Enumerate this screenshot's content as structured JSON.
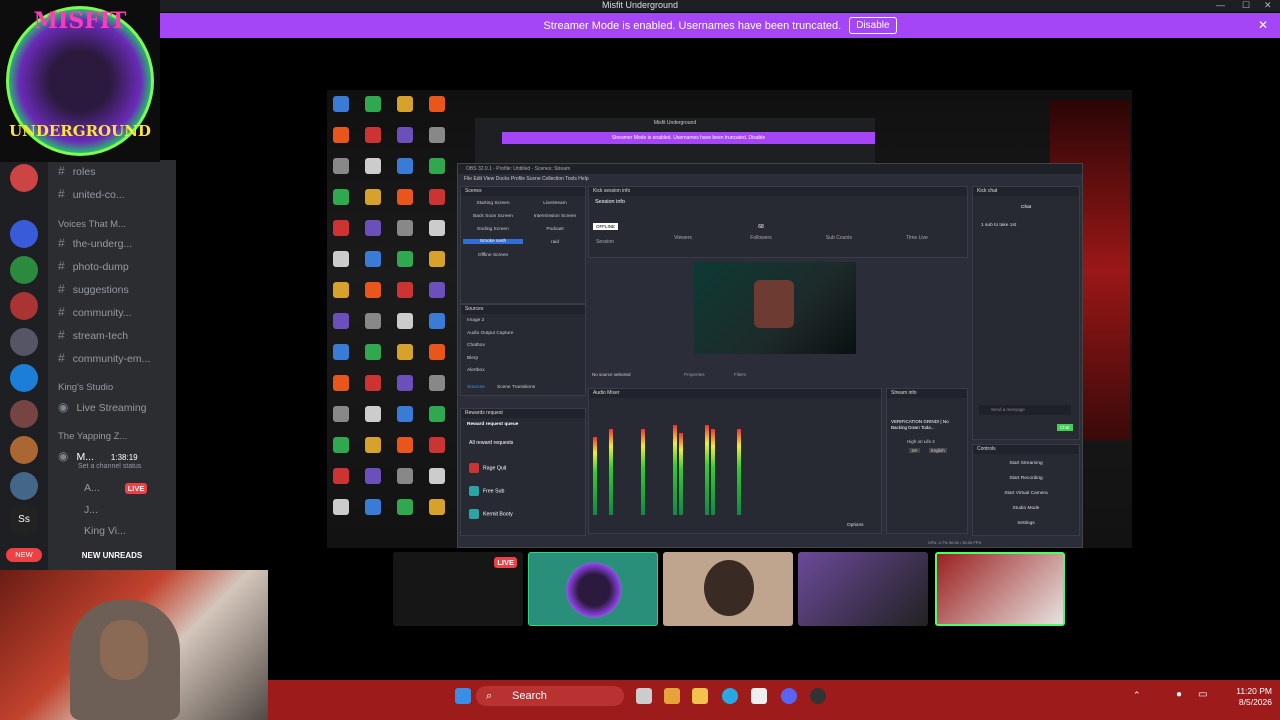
{
  "window": {
    "title": "Misfit Underground"
  },
  "banner": {
    "text": "Streamer Mode is enabled. Usernames have been truncated.",
    "button": "Disable"
  },
  "logo": {
    "line1": "MISFIT",
    "line2": "UNDERGROUND"
  },
  "channels": {
    "items": [
      {
        "label": "roles"
      },
      {
        "label": "united-co..."
      },
      {
        "label": "Voices That M..."
      },
      {
        "label": "the-underg..."
      },
      {
        "label": "photo-dump"
      },
      {
        "label": "suggestions"
      },
      {
        "label": "community..."
      },
      {
        "label": "stream-tech"
      },
      {
        "label": "community-em..."
      }
    ],
    "category": "King's Studio",
    "live_streaming": "Live Streaming",
    "yapping": "The Yapping Z...",
    "voice_user": "M...",
    "voice_time": "1:38:19",
    "voice_status": "Set a channel status",
    "user_a": "A...",
    "user_j": "J...",
    "user_king": "King Vi...",
    "live_badge": "LIVE",
    "new_unreads": "NEW UNREADS",
    "new_badge": "NEW"
  },
  "obs": {
    "title": "OBS 32.0.1 - Profile: Untitled - Scenes: Stream",
    "menu": "File   Edit   View   Docks   Profile   Scene Collection   Tools   Help",
    "scenes_header": "Scenes",
    "scenes": [
      "Starting Screen",
      "Livestream",
      "Back Soon Screen",
      "Intermission Screen",
      "Ending Screen",
      "Podcast",
      "Smoke sesh",
      "raid",
      "Offline Screen"
    ],
    "sources_header": "Sources",
    "sources": [
      "Image 2",
      "Audio Output Capture",
      "Chatbox",
      "Blerp",
      "Alertbox"
    ],
    "tabs": [
      "Sources",
      "Scene Transitions"
    ],
    "rewards_header": "Rewards request",
    "rewards_title": "Reward request queue",
    "rewards": [
      "All reward requests",
      "Rage Quit",
      "Free Sub",
      "Kermit Booty"
    ],
    "session_header": "Kick session info",
    "session_title": "Session info",
    "offline": "OFFLINE",
    "stats": [
      "Session",
      "Viewers",
      "Followers",
      "Sub Counts",
      "Time Live"
    ],
    "followers_value": "68",
    "no_source": "No source selected",
    "properties": "Properties",
    "filters": "Filters",
    "mixer_header": "Audio Mixer",
    "stream_header": "Stream info",
    "stream_title": "VERIFICATION GRIND! | No Backing Down Toda...",
    "stream_game": "High on Life 2",
    "stream_tags": [
      "18+",
      "English"
    ],
    "chat_header": "Kick chat",
    "chat_tab": "Chat",
    "chat_msg": "1 sub to take 1st",
    "chat_placeholder": "Send a message",
    "chat_button": "Chat",
    "controls_header": "Controls",
    "controls": [
      "Start Streaming",
      "Start Recording",
      "Start Virtual Camera",
      "Studio Mode",
      "Settings"
    ],
    "options": "Options",
    "status": "CPU: 2.7%   30.00 / 30.00 FPS"
  },
  "nested": {
    "title": "Misfit Underground",
    "banner": "Streamer Mode is enabled. Usernames have been truncated.   Disable"
  },
  "tiles": {
    "live": "LIVE"
  },
  "taskbar": {
    "search": "Search",
    "time": "11:20 PM",
    "date": "8/5/2026"
  }
}
